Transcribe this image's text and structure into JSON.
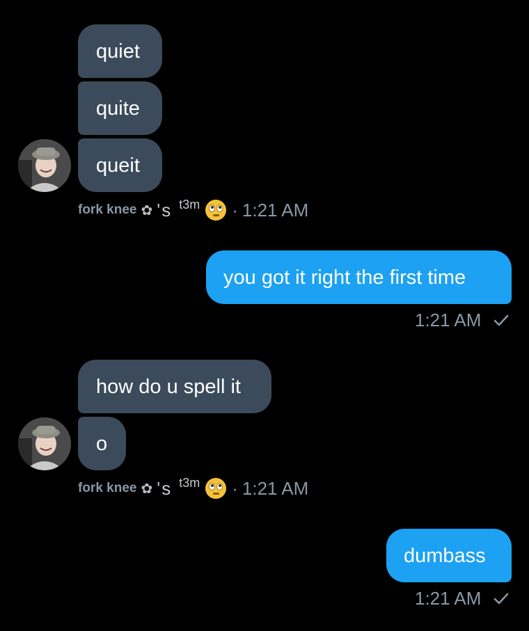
{
  "conversation": {
    "group1": {
      "messages": [
        "quiet",
        "quite",
        "queit"
      ],
      "sender": {
        "name": "fork knee",
        "flower": "✿",
        "apos": "'",
        "s": "s",
        "team": "t3m",
        "emoji": "face-with-rolling-eyes"
      },
      "time": "1:21 AM"
    },
    "reply1": {
      "text": "you got it right the first time",
      "time": "1:21 AM",
      "status": "✓"
    },
    "group2": {
      "messages": [
        "how do u spell it",
        "o"
      ],
      "sender": {
        "name": "fork knee",
        "flower": "✿",
        "apos": "'",
        "s": "s",
        "team": "t3m",
        "emoji": "face-with-rolling-eyes"
      },
      "time": "1:21 AM"
    },
    "reply2": {
      "text": "dumbass",
      "time": "1:21 AM",
      "status": "✓"
    }
  },
  "colors": {
    "background": "#000000",
    "incoming_bubble": "#3b4b5c",
    "outgoing_bubble": "#1da1f2",
    "meta_text": "#8b98a5"
  }
}
